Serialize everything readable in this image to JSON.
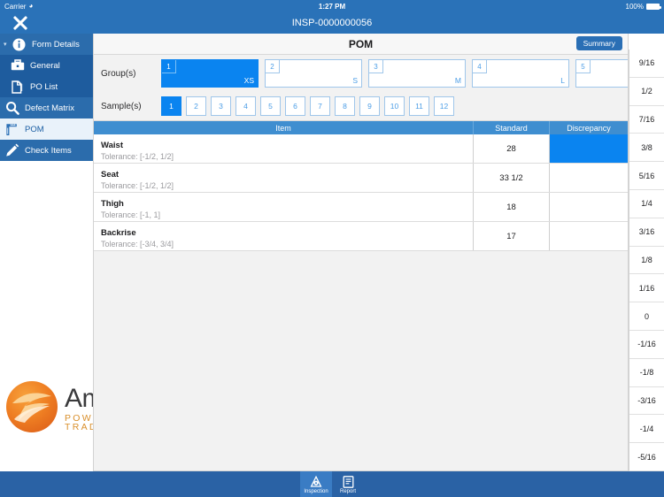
{
  "status_bar": {
    "carrier": "Carrier",
    "wifi_icon": "wifi-icon",
    "time": "1:27 PM",
    "battery_percent": "100%"
  },
  "navbar": {
    "close_icon": "close-icon",
    "title": "INSP-0000000056"
  },
  "sidebar": {
    "items": [
      {
        "label": "Form Details",
        "icon": "info-icon",
        "level": 0,
        "active": false,
        "chevron": "▾"
      },
      {
        "label": "General",
        "icon": "briefcase-icon",
        "level": 1,
        "active": false
      },
      {
        "label": "PO List",
        "icon": "document-icon",
        "level": 1,
        "active": false
      },
      {
        "label": "Defect Matrix",
        "icon": "search-icon",
        "level": 0,
        "active": false
      },
      {
        "label": "POM",
        "icon": "ruler-icon",
        "level": 0,
        "active": true
      },
      {
        "label": "Check Items",
        "icon": "pencil-icon",
        "level": 0,
        "active": false
      }
    ]
  },
  "logo": {
    "name": "Amber Road",
    "tagline": "POWERING GLOBAL TRADE",
    "mark_icon": "amber-road-swoosh-logo"
  },
  "content": {
    "title": "POM",
    "summary_label": "Summary",
    "groups_label": "Group(s)",
    "samples_label": "Sample(s)",
    "groups": [
      {
        "number": "1",
        "size": "XS",
        "selected": true
      },
      {
        "number": "2",
        "size": "S",
        "selected": false
      },
      {
        "number": "3",
        "size": "M",
        "selected": false
      },
      {
        "number": "4",
        "size": "L",
        "selected": false
      },
      {
        "number": "5",
        "size": "",
        "selected": false
      }
    ],
    "samples": [
      {
        "number": "1",
        "selected": true
      },
      {
        "number": "2",
        "selected": false
      },
      {
        "number": "3",
        "selected": false
      },
      {
        "number": "4",
        "selected": false
      },
      {
        "number": "5",
        "selected": false
      },
      {
        "number": "6",
        "selected": false
      },
      {
        "number": "7",
        "selected": false
      },
      {
        "number": "8",
        "selected": false
      },
      {
        "number": "9",
        "selected": false
      },
      {
        "number": "10",
        "selected": false
      },
      {
        "number": "11",
        "selected": false
      },
      {
        "number": "12",
        "selected": false
      }
    ],
    "table": {
      "columns": [
        "Item",
        "Standard",
        "Discrepancy"
      ],
      "rows": [
        {
          "item": "Waist",
          "tolerance": "Tolerance: [-1/2, 1/2]",
          "standard": "28",
          "discrepancy": "",
          "discrepancy_selected": true
        },
        {
          "item": "Seat",
          "tolerance": "Tolerance: [-1/2, 1/2]",
          "standard": "33 1/2",
          "discrepancy": "",
          "discrepancy_selected": false
        },
        {
          "item": "Thigh",
          "tolerance": "Tolerance: [-1, 1]",
          "standard": "18",
          "discrepancy": "",
          "discrepancy_selected": false
        },
        {
          "item": "Backrise",
          "tolerance": "Tolerance: [-3/4, 3/4]",
          "standard": "17",
          "discrepancy": "",
          "discrepancy_selected": false
        }
      ]
    }
  },
  "fraction_picker": {
    "values": [
      "9/16",
      "1/2",
      "7/16",
      "3/8",
      "5/16",
      "1/4",
      "3/16",
      "1/8",
      "1/16",
      "0",
      "-1/16",
      "-1/8",
      "-3/16",
      "-1/4",
      "-5/16"
    ]
  },
  "tabbar": {
    "tabs": [
      {
        "label": "Inspection",
        "icon": "inspection-icon",
        "active": true
      },
      {
        "label": "Report",
        "icon": "report-icon",
        "active": false
      }
    ]
  },
  "colors": {
    "brand_blue": "#2a72b8",
    "selection_blue": "#0a84f0",
    "table_header_blue": "#3f8ed0",
    "sidebar_sub_blue": "#1e5c9e",
    "logo_orange": "#d98f2b"
  }
}
